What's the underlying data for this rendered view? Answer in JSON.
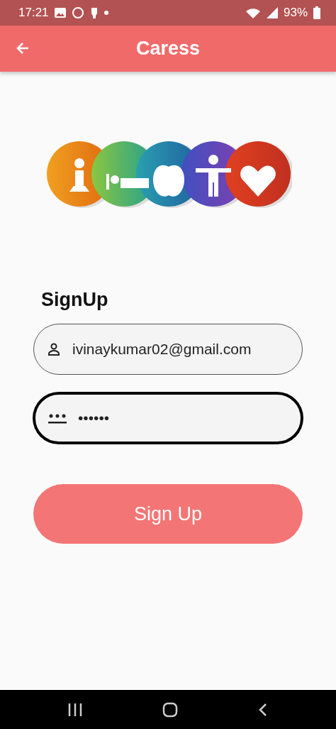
{
  "status_bar": {
    "time": "17:21",
    "battery": "93%"
  },
  "app_bar": {
    "title": "Caress"
  },
  "form": {
    "heading": "SignUp",
    "fields": [
      {
        "kind": "email",
        "value": "ivinaykumar02@gmail.com",
        "focused": false
      },
      {
        "kind": "password",
        "value": "••••••",
        "focused": true
      }
    ],
    "submit": "Sign Up"
  }
}
